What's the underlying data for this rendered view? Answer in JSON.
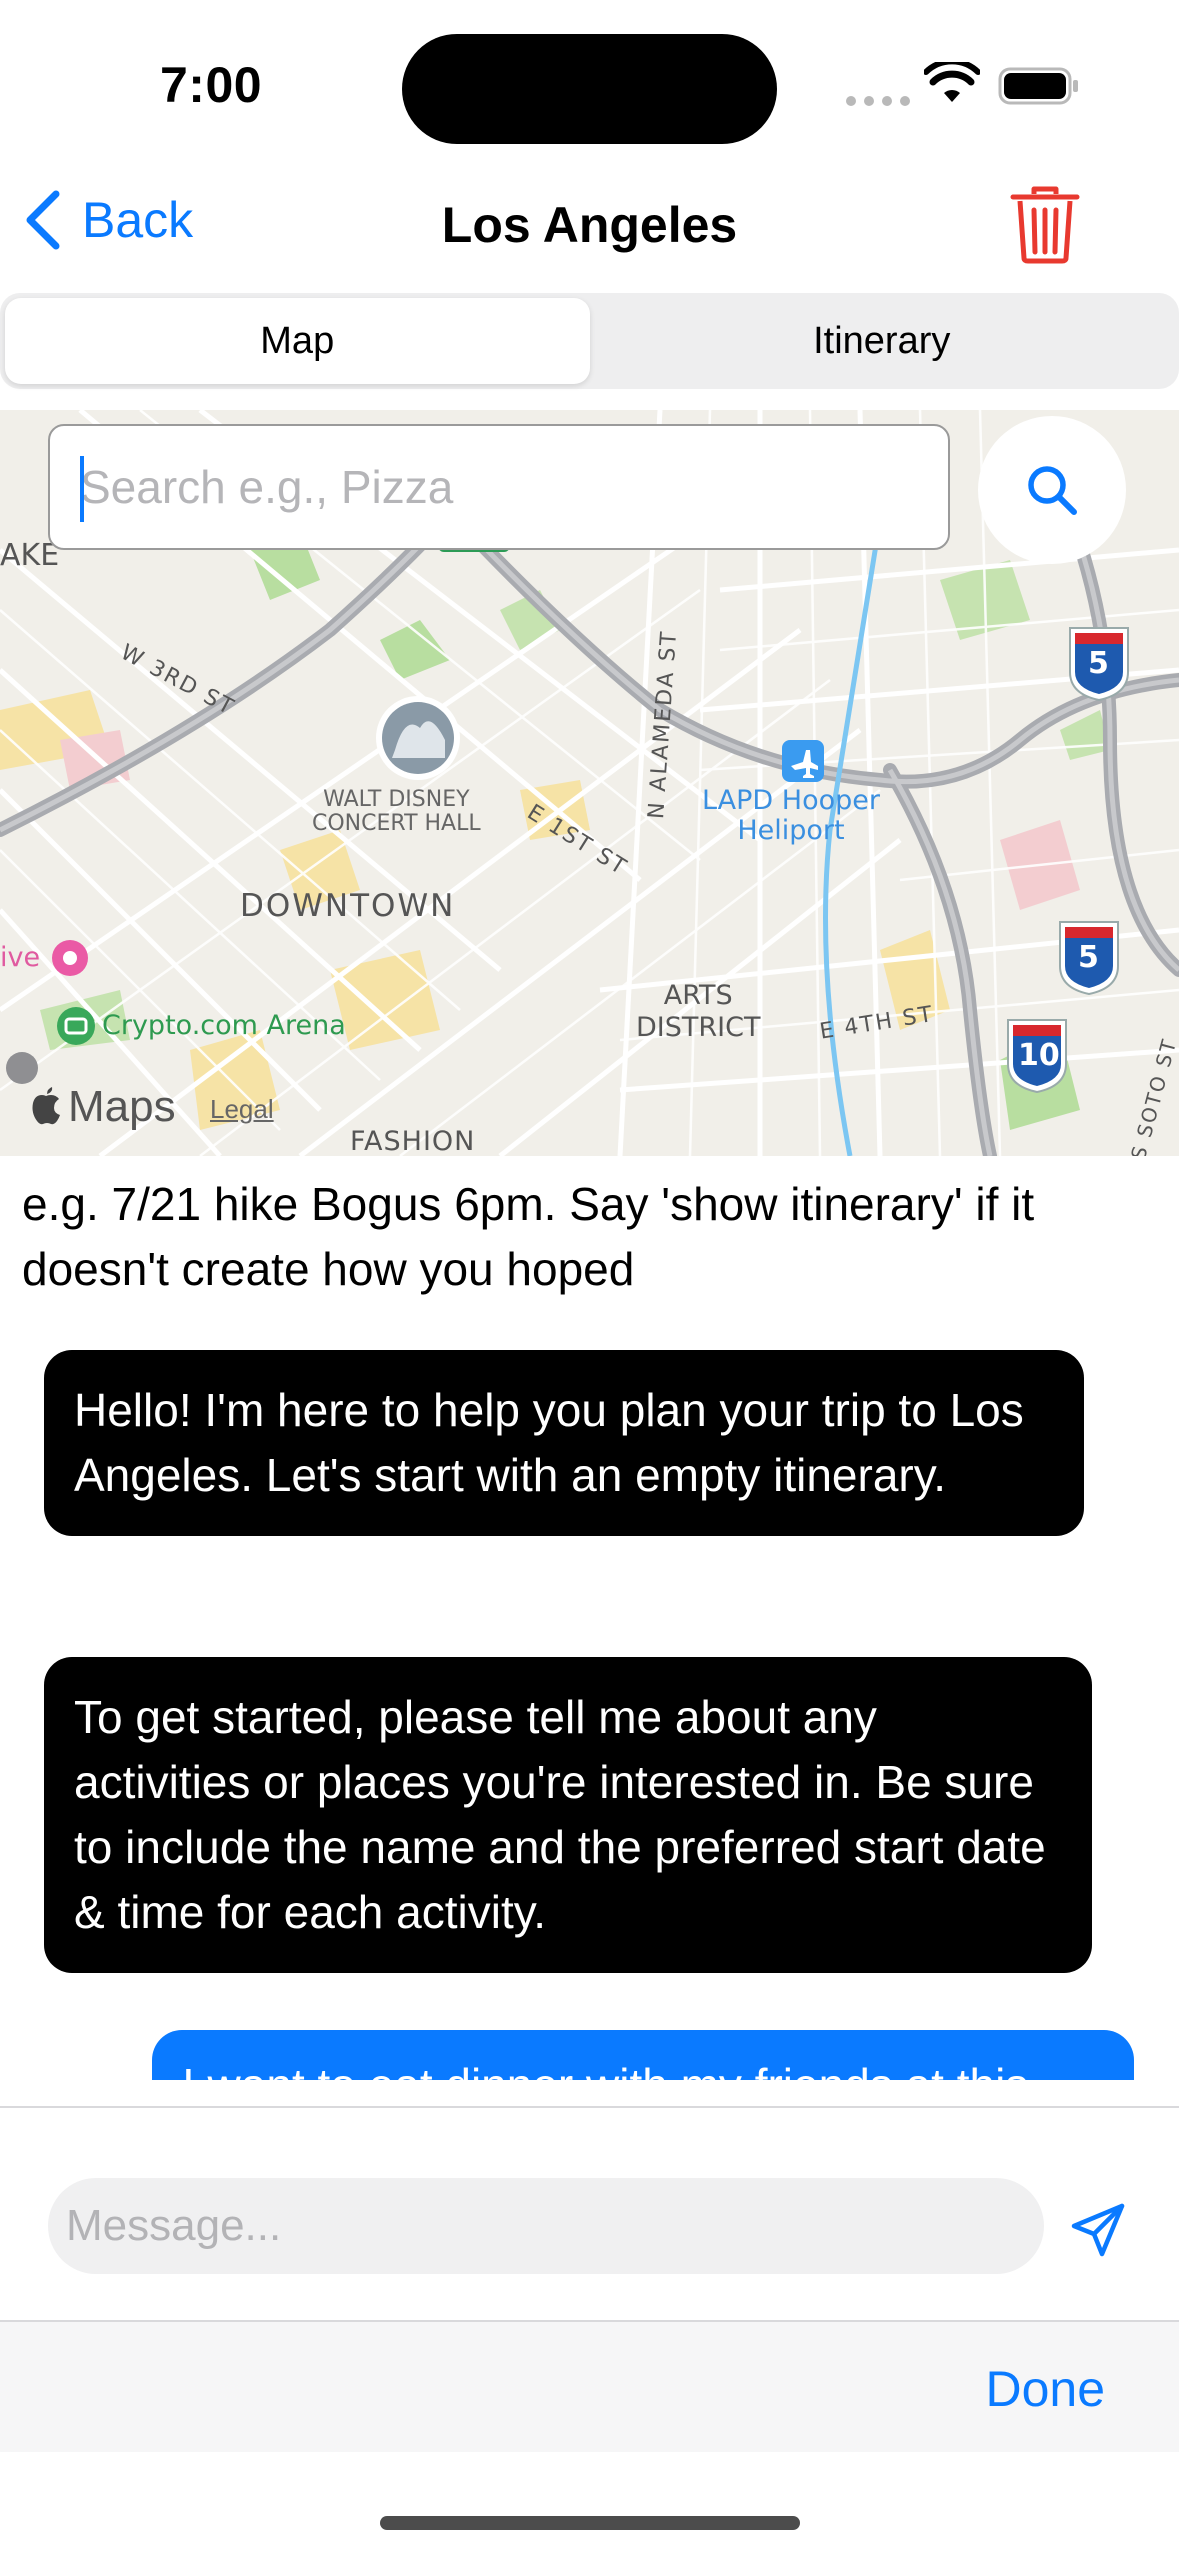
{
  "status_bar": {
    "time": "7:00"
  },
  "nav": {
    "back_label": "Back",
    "title": "Los Angeles"
  },
  "tabs": [
    {
      "label": "Map",
      "active": true
    },
    {
      "label": "Itinerary",
      "active": false
    }
  ],
  "map": {
    "search_placeholder": "Search e.g., Pizza",
    "labels": {
      "ake": "AKE",
      "w3rd": "W 3RD ST",
      "concert_hall": "WALT DISNEY\nCONCERT HALL",
      "e1st": "E 1ST ST",
      "alameda": "N ALAMEDA ST",
      "heliport": "LAPD Hooper\nHeliport",
      "downtown": "DOWNTOWN",
      "arena": "Crypto.com Arena",
      "ive": "ive",
      "arts": "ARTS\nDISTRICT",
      "e4th": "E 4TH ST",
      "fashion": "FASHION",
      "soto": "S SOTO ST",
      "hwy5_a": "5",
      "hwy5_b": "5",
      "hwy10": "10"
    },
    "brand": "Maps",
    "legal": "Legal"
  },
  "hint": "e.g. 7/21 hike Bogus 6pm. Say 'show itinerary' if it doesn't create how you hoped",
  "messages": [
    {
      "role": "assistant",
      "text": "Hello! I'm here to help you plan your trip to Los Angeles. Let's start with an empty itinerary."
    },
    {
      "role": "assistant",
      "text": "To get started, please tell me about any activities or places you're interested in. Be sure to include the name and the preferred start date & time for each activity."
    },
    {
      "role": "user",
      "text": "I want to eat dinner with my friends at this"
    }
  ],
  "composer": {
    "placeholder": "Message..."
  },
  "keyboard_accessory": {
    "done_label": "Done"
  },
  "colors": {
    "accent": "#0a7aff",
    "destructive": "#e8392f",
    "bubble_assistant": "#000000",
    "bubble_user": "#0a7aff"
  }
}
